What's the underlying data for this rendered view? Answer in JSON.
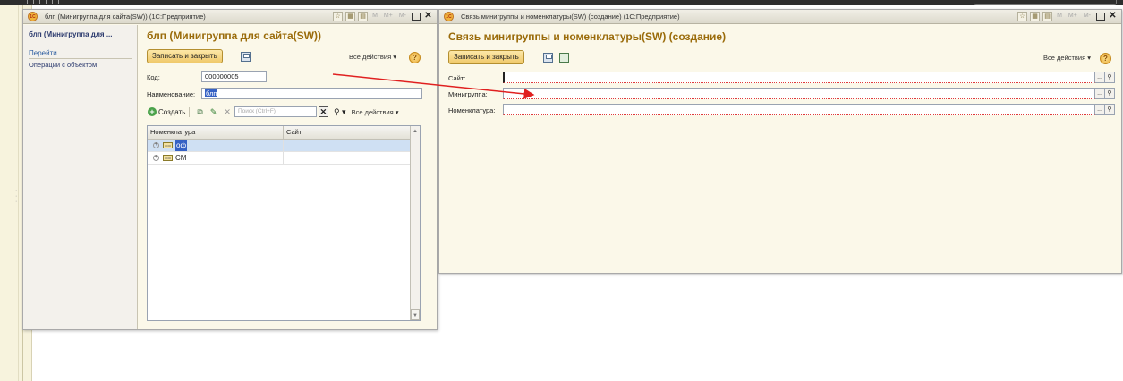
{
  "window1": {
    "title": "блп (Минигруппа для сайта(SW))  (1С:Предприятие)",
    "titlebar_buttons": {
      "m": "M",
      "mplus": "M+",
      "mminus": "M-"
    },
    "nav": {
      "title": "блп (Минигруппа для ...",
      "goto_label": "Перейти",
      "items": [
        "Операции с объектом"
      ]
    },
    "form_title": "блп (Минигруппа для сайта(SW))",
    "save_close_label": "Записать и закрыть",
    "all_actions_label": "Все действия ▾",
    "fields": {
      "code_label": "Код:",
      "code_value": "000000005",
      "name_label": "Наименование:",
      "name_value": "блп"
    },
    "toolbar": {
      "create_label": "Создать",
      "search_placeholder": "Поиск (Ctrl+F)",
      "all_actions_label": "Все действия ▾"
    },
    "table": {
      "columns": [
        "Номенклатура",
        "Сайт"
      ],
      "rows": [
        {
          "nomenclature": "оф",
          "site": ""
        },
        {
          "nomenclature": "СМ",
          "site": ""
        }
      ]
    }
  },
  "window2": {
    "title": "Связь минигруппы и номенклатуры(SW) (создание)  (1С:Предприятие)",
    "titlebar_buttons": {
      "m": "M",
      "mplus": "M+",
      "mminus": "M-"
    },
    "form_title": "Связь минигруппы и номенклатуры(SW) (создание)",
    "save_close_label": "Записать и закрыть",
    "all_actions_label": "Все действия ▾",
    "fields": [
      {
        "label": "Сайт:",
        "value": ""
      },
      {
        "label": "Минигруппа:",
        "value": ""
      },
      {
        "label": "Номенклатура:",
        "value": ""
      }
    ]
  },
  "colors": {
    "annotation_arrow": "#e02020",
    "form_title": "#9a6b0a",
    "accent_button": "#f0c96a"
  }
}
